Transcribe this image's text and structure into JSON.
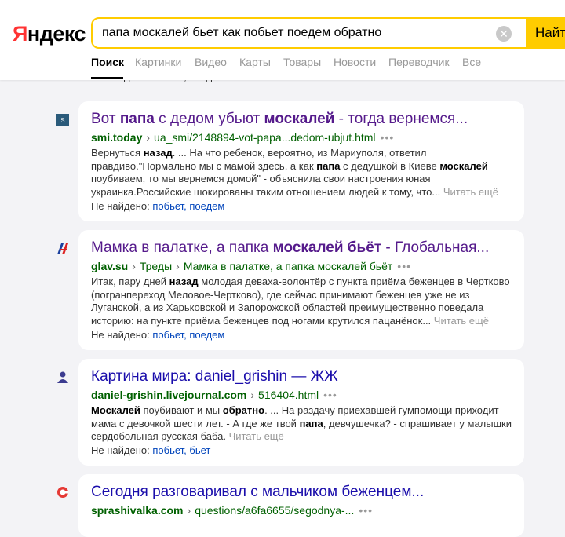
{
  "header": {
    "logo": "Яндекс",
    "search_query": "папа москалей бьет как побьет поедем обратно",
    "find_label": "Найти",
    "clear_icon": "close-icon"
  },
  "tabs": [
    {
      "label": "Поиск",
      "active": true
    },
    {
      "label": "Картинки"
    },
    {
      "label": "Видео"
    },
    {
      "label": "Карты"
    },
    {
      "label": "Товары"
    },
    {
      "label": "Новости"
    },
    {
      "label": "Переводчик"
    },
    {
      "label": "Все"
    }
  ],
  "prev_tail": "Не найдено: побьет, поедем",
  "results": [
    {
      "title_parts": [
        "Вот ",
        "папа",
        " с дедом убьют ",
        "москалей",
        " - тогда вернемся..."
      ],
      "host": "smi.today",
      "path": "ua_smi/2148894-vot-papa...dedom-ubjut.html",
      "snippet_parts": [
        "Вернуться ",
        "назад",
        ". ... На что ребенок, вероятно, из Мариуполя, ответил правдиво.\"Нормально мы с мамой здесь, а как ",
        "папа",
        " с дедушкой в Киеве ",
        "москалей",
        " поубиваем, то мы вернемся домой\" - объяснила свои настроения юная украинка.Российские шокированы таким отношением людей к тому, что... "
      ],
      "read_more": "Читать ещё",
      "not_found_label": "Не найдено: ",
      "not_found_words": "побьет, поедем"
    },
    {
      "title_parts": [
        "Мамка в палатке, а папка ",
        "москалей бьёт",
        " - Глобальная..."
      ],
      "host": "glav.su",
      "crumbs": [
        "Треды",
        "Мамка в палатке, а папка москалей бьёт"
      ],
      "snippet_parts": [
        "Итак, пару дней ",
        "назад",
        " молодая деваха-волонтёр с пункта приёма беженцев в Чертково (погранпереход Меловое-Чертково), где сейчас принимают беженцев уже не из Луганской, а из Харьковской и Запорожской областей преимущественно поведала историю: на пункте приёма беженцев под ногами крутился пацанёнок... "
      ],
      "read_more": "Читать ещё",
      "not_found_label": "Не найдено: ",
      "not_found_words": "побьет, поедем"
    },
    {
      "title_parts": [
        "Картина мира: daniel_grishin — ЖЖ"
      ],
      "host": "daniel-grishin.livejournal.com",
      "path": "516404.html",
      "snippet_parts": [
        "Москалей",
        " поубивают и мы ",
        "обратно",
        ". ... На раздачу приехавшей гумпомощи приходит мама с девочкой шести лет. - А где же твой ",
        "папа",
        ", девчушечка? - спрашивает у малышки сердобольная русская баба. "
      ],
      "read_more": "Читать ещё",
      "not_found_label": "Не найдено: ",
      "not_found_words": "побьет, бьет"
    },
    {
      "title_parts": [
        "Сегодня разговаривал с мальчиком беженцем..."
      ],
      "host": "sprashivalka.com",
      "path": "questions/a6fa6655/segodnya-..."
    }
  ]
}
